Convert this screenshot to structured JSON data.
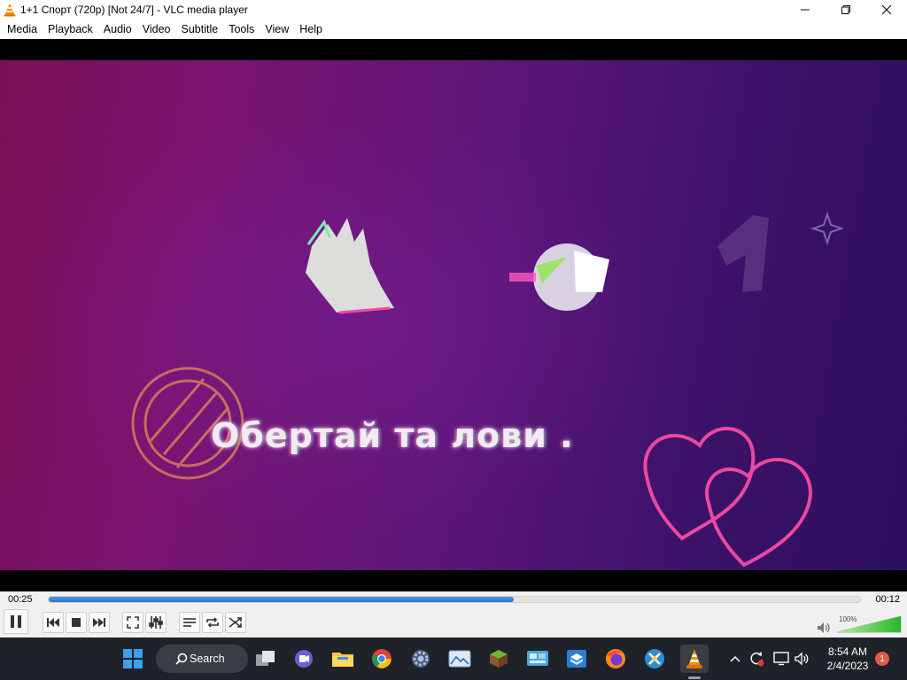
{
  "window": {
    "title": "1+1 Спорт (720p) [Not 24/7] - VLC media player",
    "controls": [
      "minimize",
      "maximize",
      "close"
    ]
  },
  "menu": [
    "Media",
    "Playback",
    "Audio",
    "Video",
    "Subtitle",
    "Tools",
    "View",
    "Help"
  ],
  "video": {
    "caption": "Обертай та лови ."
  },
  "player": {
    "elapsed": "00:25",
    "remaining": "00:12",
    "progress": 0.573,
    "volume_label": "100%",
    "volume_level": 1.0,
    "buttons": [
      "pause",
      "previous",
      "stop",
      "next",
      "fullscreen",
      "extended-settings",
      "playlist",
      "loop",
      "random"
    ]
  },
  "taskbar": {
    "search_label": "Search",
    "apps": [
      "start",
      "search",
      "task-view",
      "teams",
      "file-explorer",
      "chrome",
      "settings",
      "photos",
      "minecraft",
      "control-panel",
      "sandbox",
      "firefox",
      "tools",
      "vlc"
    ],
    "clock_time": "8:54 AM",
    "clock_date": "2/4/2023",
    "notification_count": "1"
  },
  "colors": {
    "seek_fill": "#2c74c9",
    "taskbar_bg": "#1f2229",
    "volume_green": "#2ab52a"
  }
}
